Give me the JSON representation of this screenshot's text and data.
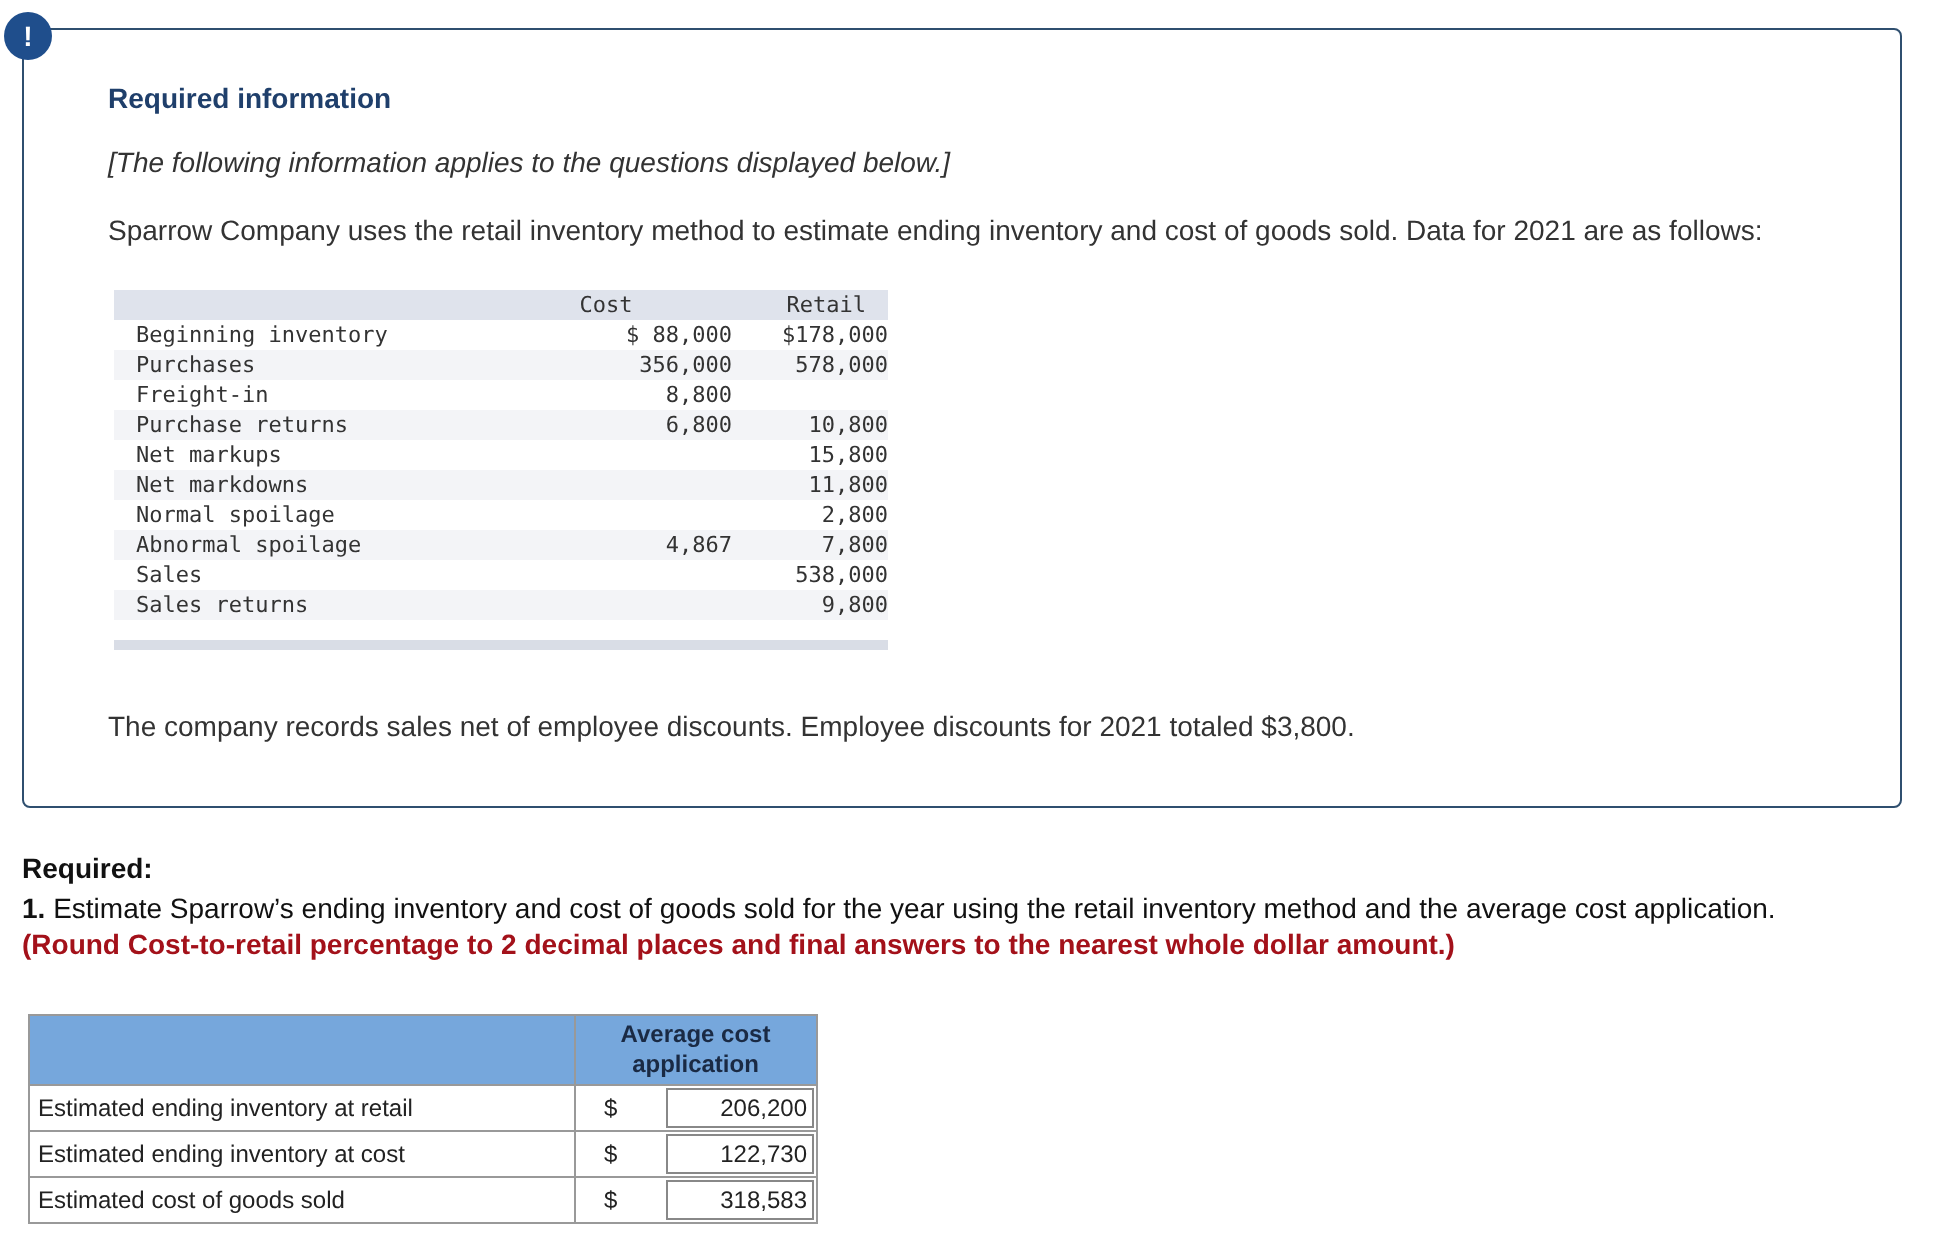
{
  "alert_badge": "!",
  "info_box": {
    "title": "Required information",
    "note": "[The following information applies to the questions displayed below.]",
    "intro": "Sparrow Company uses the retail inventory method to estimate ending inventory and cost of goods sold. Data for 2021 are as follows:",
    "data_table": {
      "columns": [
        "Cost",
        "Retail"
      ],
      "rows": [
        {
          "label": "Beginning inventory",
          "cost": "$ 88,000",
          "retail": "$178,000"
        },
        {
          "label": "Purchases",
          "cost": "356,000",
          "retail": "578,000"
        },
        {
          "label": "Freight-in",
          "cost": "8,800"
        },
        {
          "label": "Purchase returns",
          "cost": "6,800",
          "retail": "10,800"
        },
        {
          "label": "Net markups",
          "retail": "15,800"
        },
        {
          "label": "Net markdowns",
          "retail": "11,800"
        },
        {
          "label": "Normal spoilage",
          "retail": "2,800"
        },
        {
          "label": "Abnormal spoilage",
          "cost": "4,867",
          "retail": "7,800"
        },
        {
          "label": "Sales",
          "retail": "538,000"
        },
        {
          "label": "Sales returns",
          "retail": "9,800"
        }
      ]
    },
    "footer": "The company records sales net of employee discounts. Employee discounts for 2021 totaled $3,800."
  },
  "required": {
    "heading": "Required:",
    "question": "**1.** Estimate Sparrow’s ending inventory and cost of goods sold for the year using the retail inventory method and the average cost application.",
    "instruction": "(Round Cost-to-retail percentage to 2 decimal places and final answers to the nearest whole dollar amount.)"
  },
  "answer_table": {
    "column": "Average cost application",
    "rows": [
      {
        "label": "Estimated ending inventory at retail",
        "currency": "$",
        "value": "206,200"
      },
      {
        "label": "Estimated ending inventory at cost",
        "currency": "$",
        "value": "122,730"
      },
      {
        "label": "Estimated cost of goods sold",
        "currency": "$",
        "value": "318,583"
      }
    ]
  }
}
